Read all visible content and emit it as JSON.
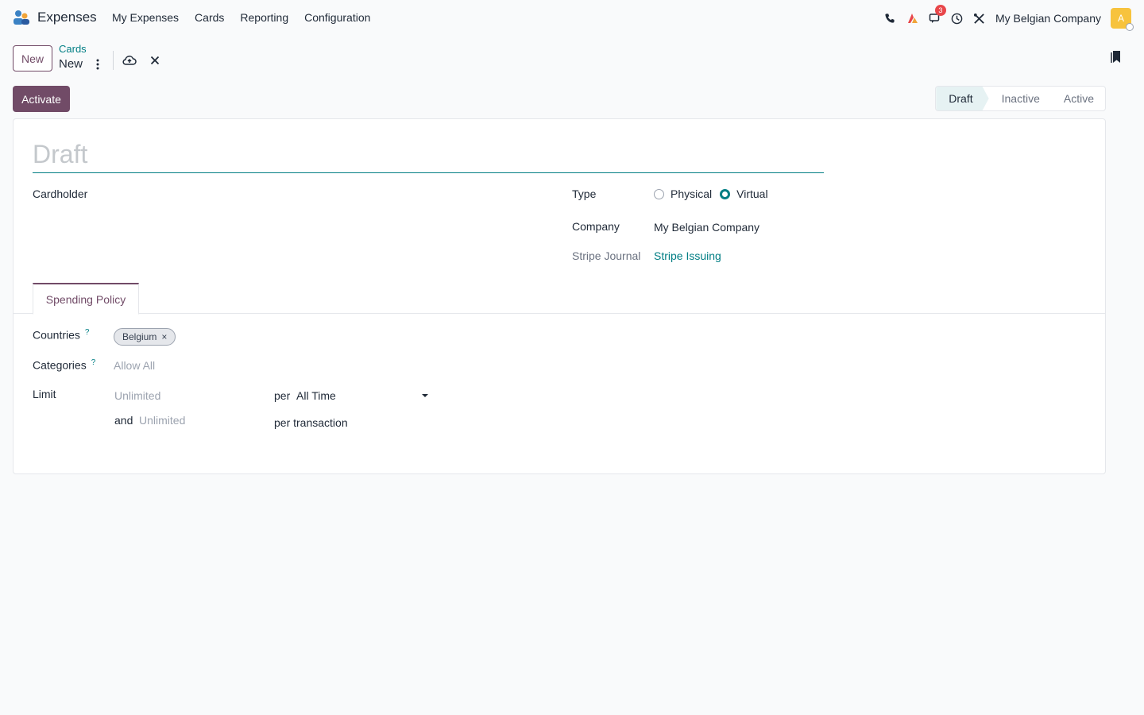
{
  "app": {
    "title": "Expenses"
  },
  "menu": [
    "My Expenses",
    "Cards",
    "Reporting",
    "Configuration"
  ],
  "systray": {
    "chat_badge": "3",
    "company": "My Belgian Company",
    "avatar_letter": "A"
  },
  "control_panel": {
    "new_label": "New",
    "breadcrumb_parent": "Cards",
    "breadcrumb_current": "New"
  },
  "header": {
    "activate_label": "Activate",
    "stages": [
      "Draft",
      "Inactive",
      "Active"
    ],
    "active_stage": "Draft"
  },
  "form": {
    "name_placeholder": "Draft",
    "cardholder_label": "Cardholder",
    "type_label": "Type",
    "type_options": [
      "Physical",
      "Virtual"
    ],
    "type_selected": "Virtual",
    "company_label": "Company",
    "company_value": "My Belgian Company",
    "journal_label": "Stripe Journal",
    "journal_value": "Stripe Issuing"
  },
  "tabs": [
    "Spending Policy"
  ],
  "policy": {
    "countries_label": "Countries",
    "countries_tags": [
      "Belgium"
    ],
    "categories_label": "Categories",
    "categories_placeholder": "Allow All",
    "limit_label": "Limit",
    "limit_placeholder": "Unlimited",
    "per_label": "per",
    "period_value": "All Time",
    "and_label": "and",
    "tx_limit_placeholder": "Unlimited",
    "per_transaction_label": "per transaction"
  },
  "colors": {
    "brand": "#714b67",
    "accent": "#017e84"
  }
}
